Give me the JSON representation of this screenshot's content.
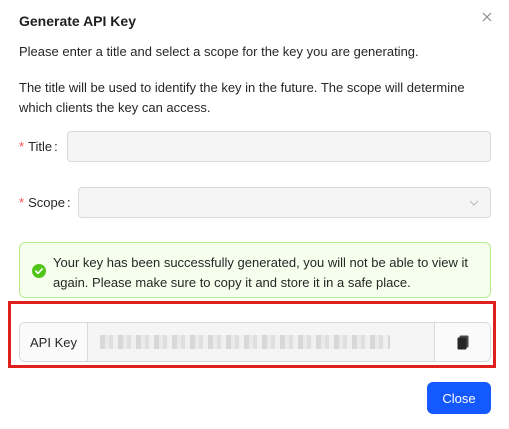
{
  "dialog": {
    "title": "Generate API Key",
    "description_1": "Please enter a title and select a scope for the key you are generating.",
    "description_2": "The title will be used to identify the key in the future. The scope will determine which clients the key can access."
  },
  "form": {
    "title_label": "Title",
    "title_value": "",
    "scope_label": "Scope",
    "scope_value": "",
    "required_mark": "*",
    "colon": ":"
  },
  "alert": {
    "type": "success",
    "message": "Your key has been successfully generated, you will not be able to view it again. Please make sure to copy it and store it in a safe place."
  },
  "api_key": {
    "label": "API Key"
  },
  "footer": {
    "close_label": "Close"
  },
  "colors": {
    "primary": "#1458ff",
    "success": "#52c41a",
    "highlight": "#e0201c",
    "required": "#ff4d4f"
  },
  "icons": {
    "dialog_close": "close-icon",
    "scope_chevron": "chevron-down-icon",
    "success": "check-circle-icon",
    "copy": "copy-icon"
  }
}
